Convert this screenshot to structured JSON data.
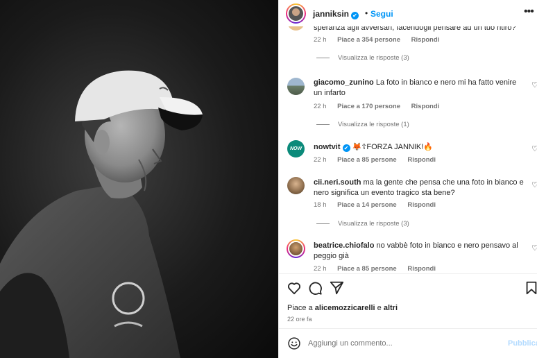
{
  "post": {
    "username": "janniksin",
    "verified_mark": "✔",
    "separator": "•",
    "follow_label": "Segui",
    "more_label": "•••"
  },
  "comments": [
    {
      "text": "speranza agli avversari, facendogli pensare ad un tuo ritiro?",
      "time": "22 h",
      "likes": "Piace a 354 persone",
      "reply": "Rispondi",
      "replies": "Visualizza le risposte (3)"
    },
    {
      "user": "giacomo_zunino",
      "text": "La foto in bianco e nero mi ha fatto venire un infarto",
      "time": "22 h",
      "likes": "Piace a 170 persone",
      "reply": "Rispondi",
      "replies": "Visualizza le risposte (1)"
    },
    {
      "user": "nowtvit",
      "avatar_text": "NOW",
      "text": "🦊☦FORZA JANNIK!🔥",
      "time": "22 h",
      "likes": "Piace a 85 persone",
      "reply": "Rispondi"
    },
    {
      "user": "cii.neri.south",
      "text": "ma la gente che pensa che una foto in bianco e nero significa un evento tragico sta bene?",
      "time": "18 h",
      "likes": "Piace a 14 persone",
      "reply": "Rispondi",
      "replies": "Visualizza le risposte (3)"
    },
    {
      "user": "beatrice.chiofalo",
      "text": "no vabbè foto in bianco e nero pensavo al peggio già",
      "time": "22 h",
      "likes": "Piace a 85 persone",
      "reply": "Rispondi"
    }
  ],
  "likes_line": {
    "prefix": "Piace a",
    "user": "alicemozzicarelli",
    "conj": "e",
    "others": "altri"
  },
  "post_time": "22 ore fa",
  "composer": {
    "placeholder": "Aggiungi un commento...",
    "publish_label": "Pubblica"
  },
  "colors": {
    "accent": "#0095f6",
    "publish_disabled": "#b3dbff",
    "nowtv": "#0b8a7a"
  },
  "icons": [
    "heart-icon",
    "comment-icon",
    "share-icon",
    "bookmark-icon",
    "emoji-icon",
    "more-icon"
  ]
}
